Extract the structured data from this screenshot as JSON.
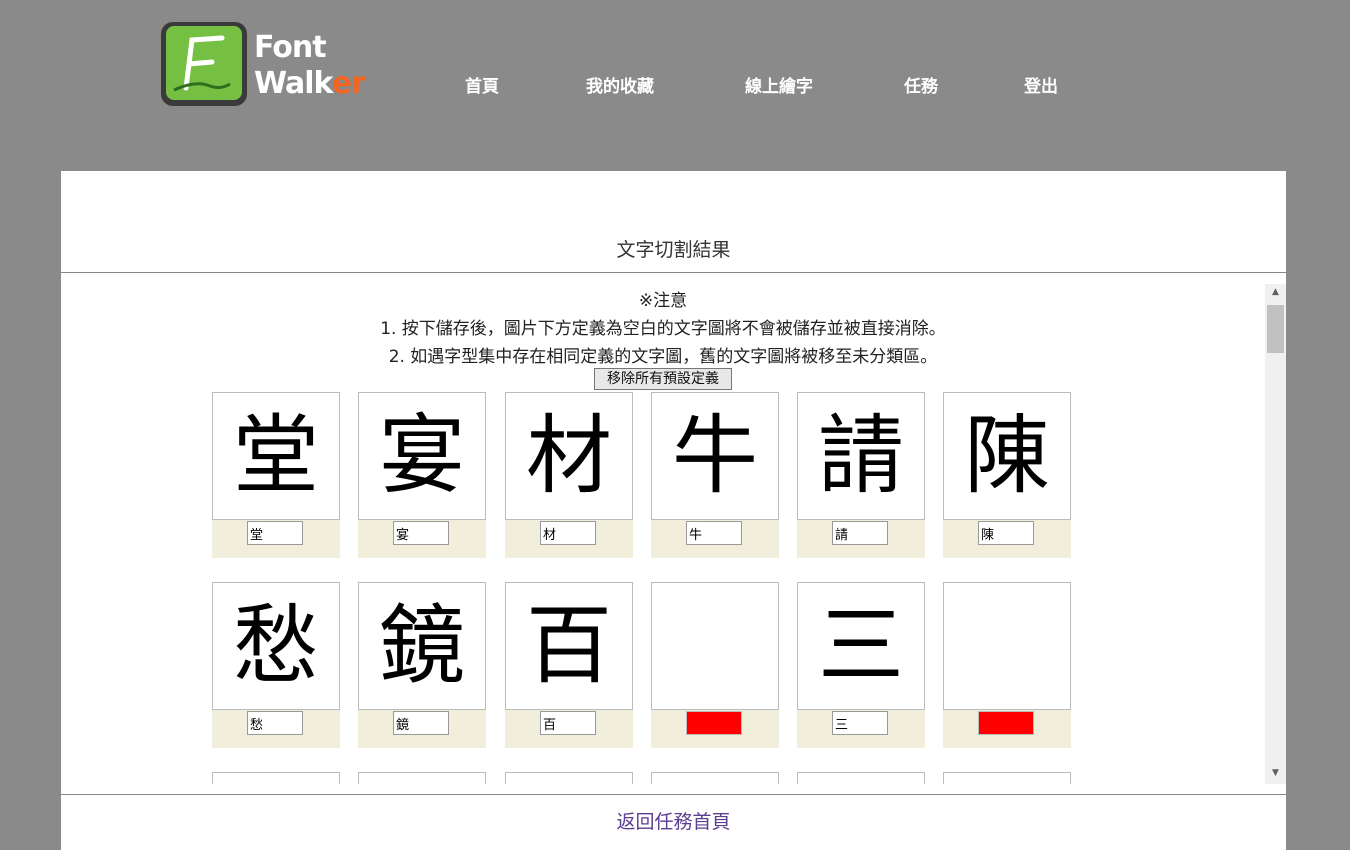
{
  "logo": {
    "line1": "Font",
    "line2_main": "Walk",
    "line2_accent": "er"
  },
  "nav": [
    "首頁",
    "我的收藏",
    "線上繪字",
    "任務",
    "登出"
  ],
  "panel": {
    "title": "文字切割結果",
    "back_link": "返回任務首頁"
  },
  "notice": {
    "heading": "※注意",
    "line1": "1. 按下儲存後，圖片下方定義為空白的文字圖將不會被儲存並被直接消除。",
    "line2": "2. 如遇字型集中存在相同定義的文字圖，舊的文字圖將被移至未分類區。"
  },
  "remove_button": "移除所有預設定義",
  "cards": [
    {
      "glyph": "堂",
      "value": "堂",
      "empty": false
    },
    {
      "glyph": "宴",
      "value": "宴",
      "empty": false
    },
    {
      "glyph": "材",
      "value": "材",
      "empty": false
    },
    {
      "glyph": "牛",
      "value": "牛",
      "empty": false
    },
    {
      "glyph": "請",
      "value": "請",
      "empty": false
    },
    {
      "glyph": "陳",
      "value": "陳",
      "empty": false
    },
    {
      "glyph": "愁",
      "value": "愁",
      "empty": false
    },
    {
      "glyph": "鏡",
      "value": "鏡",
      "empty": false
    },
    {
      "glyph": "百",
      "value": "百",
      "empty": false
    },
    {
      "glyph": "",
      "value": "",
      "empty": true
    },
    {
      "glyph": "三",
      "value": "三",
      "empty": false
    },
    {
      "glyph": "",
      "value": "",
      "empty": true
    }
  ],
  "colors": {
    "background": "#8a8a8a",
    "empty_field": "#ff0000",
    "label_bg": "#f1efdc",
    "link": "#5b3e8f",
    "logo_green": "#75c043",
    "logo_accent": "#f26522"
  }
}
